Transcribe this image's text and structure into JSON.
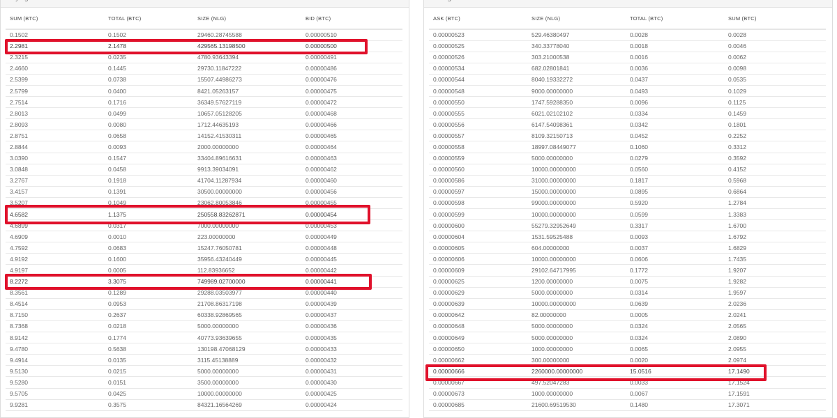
{
  "colors": {
    "highlight": "#e0112b",
    "border": "#dcdcdc"
  },
  "buying": {
    "title": "Buying",
    "columns": [
      "SUM (BTC)",
      "TOTAL (BTC)",
      "SIZE (NLG)",
      "BID (BTC)"
    ],
    "rows": [
      [
        "0.1502",
        "0.1502",
        "29460.28745588",
        "0.00000510"
      ],
      [
        "2.2981",
        "2.1478",
        "429565.13198500",
        "0.00000500"
      ],
      [
        "2.3215",
        "0.0235",
        "4780.93643394",
        "0.00000491"
      ],
      [
        "2.4660",
        "0.1445",
        "29730.11847222",
        "0.00000486"
      ],
      [
        "2.5399",
        "0.0738",
        "15507.44986273",
        "0.00000476"
      ],
      [
        "2.5799",
        "0.0400",
        "8421.05263157",
        "0.00000475"
      ],
      [
        "2.7514",
        "0.1716",
        "36349.57627119",
        "0.00000472"
      ],
      [
        "2.8013",
        "0.0499",
        "10657.05128205",
        "0.00000468"
      ],
      [
        "2.8093",
        "0.0080",
        "1712.44635193",
        "0.00000466"
      ],
      [
        "2.8751",
        "0.0658",
        "14152.41530311",
        "0.00000465"
      ],
      [
        "2.8844",
        "0.0093",
        "2000.00000000",
        "0.00000464"
      ],
      [
        "3.0390",
        "0.1547",
        "33404.89616631",
        "0.00000463"
      ],
      [
        "3.0848",
        "0.0458",
        "9913.39034091",
        "0.00000462"
      ],
      [
        "3.2767",
        "0.1918",
        "41704.11287934",
        "0.00000460"
      ],
      [
        "3.4157",
        "0.1391",
        "30500.00000000",
        "0.00000456"
      ],
      [
        "3.5207",
        "0.1049",
        "23062.80053846",
        "0.00000455"
      ],
      [
        "4.6582",
        "1.1375",
        "250558.83262871",
        "0.00000454"
      ],
      [
        "4.6899",
        "0.0317",
        "7000.00000000",
        "0.00000453"
      ],
      [
        "4.6909",
        "0.0010",
        "223.00000000",
        "0.00000449"
      ],
      [
        "4.7592",
        "0.0683",
        "15247.76050781",
        "0.00000448"
      ],
      [
        "4.9192",
        "0.1600",
        "35956.43240449",
        "0.00000445"
      ],
      [
        "4.9197",
        "0.0005",
        "112.83936652",
        "0.00000442"
      ],
      [
        "8.2272",
        "3.3075",
        "749989.02700000",
        "0.00000441"
      ],
      [
        "8.3561",
        "0.1289",
        "29288.03503977",
        "0.00000440"
      ],
      [
        "8.4514",
        "0.0953",
        "21708.86317198",
        "0.00000439"
      ],
      [
        "8.7150",
        "0.2637",
        "60338.92869565",
        "0.00000437"
      ],
      [
        "8.7368",
        "0.0218",
        "5000.00000000",
        "0.00000436"
      ],
      [
        "8.9142",
        "0.1774",
        "40773.93639655",
        "0.00000435"
      ],
      [
        "9.4780",
        "0.5638",
        "130198.47068129",
        "0.00000433"
      ],
      [
        "9.4914",
        "0.0135",
        "3115.45138889",
        "0.00000432"
      ],
      [
        "9.5130",
        "0.0215",
        "5000.00000000",
        "0.00000431"
      ],
      [
        "9.5280",
        "0.0151",
        "3500.00000000",
        "0.00000430"
      ],
      [
        "9.5705",
        "0.0425",
        "10000.00000000",
        "0.00000425"
      ],
      [
        "9.9281",
        "0.3575",
        "84321.16564269",
        "0.00000424"
      ]
    ],
    "highlighted_rows": [
      1,
      16,
      22
    ]
  },
  "selling": {
    "title": "Selling",
    "columns": [
      "ASK (BTC)",
      "SIZE (NLG)",
      "TOTAL (BTC)",
      "SUM (BTC)"
    ],
    "rows": [
      [
        "0.00000523",
        "529.46380497",
        "0.0028",
        "0.0028"
      ],
      [
        "0.00000525",
        "340.33778040",
        "0.0018",
        "0.0046"
      ],
      [
        "0.00000526",
        "303.21000538",
        "0.0016",
        "0.0062"
      ],
      [
        "0.00000534",
        "682.02801841",
        "0.0036",
        "0.0098"
      ],
      [
        "0.00000544",
        "8040.19332272",
        "0.0437",
        "0.0535"
      ],
      [
        "0.00000548",
        "9000.00000000",
        "0.0493",
        "0.1029"
      ],
      [
        "0.00000550",
        "1747.59288350",
        "0.0096",
        "0.1125"
      ],
      [
        "0.00000555",
        "6021.02102102",
        "0.0334",
        "0.1459"
      ],
      [
        "0.00000556",
        "6147.54098361",
        "0.0342",
        "0.1801"
      ],
      [
        "0.00000557",
        "8109.32150713",
        "0.0452",
        "0.2252"
      ],
      [
        "0.00000558",
        "18997.08449077",
        "0.1060",
        "0.3312"
      ],
      [
        "0.00000559",
        "5000.00000000",
        "0.0279",
        "0.3592"
      ],
      [
        "0.00000560",
        "10000.00000000",
        "0.0560",
        "0.4152"
      ],
      [
        "0.00000586",
        "31000.00000000",
        "0.1817",
        "0.5968"
      ],
      [
        "0.00000597",
        "15000.00000000",
        "0.0895",
        "0.6864"
      ],
      [
        "0.00000598",
        "99000.00000000",
        "0.5920",
        "1.2784"
      ],
      [
        "0.00000599",
        "10000.00000000",
        "0.0599",
        "1.3383"
      ],
      [
        "0.00000600",
        "55279.32952649",
        "0.3317",
        "1.6700"
      ],
      [
        "0.00000604",
        "1531.59525488",
        "0.0093",
        "1.6792"
      ],
      [
        "0.00000605",
        "604.00000000",
        "0.0037",
        "1.6829"
      ],
      [
        "0.00000606",
        "10000.00000000",
        "0.0606",
        "1.7435"
      ],
      [
        "0.00000609",
        "29102.64717995",
        "0.1772",
        "1.9207"
      ],
      [
        "0.00000625",
        "1200.00000000",
        "0.0075",
        "1.9282"
      ],
      [
        "0.00000629",
        "5000.00000000",
        "0.0314",
        "1.9597"
      ],
      [
        "0.00000639",
        "10000.00000000",
        "0.0639",
        "2.0236"
      ],
      [
        "0.00000642",
        "82.00000000",
        "0.0005",
        "2.0241"
      ],
      [
        "0.00000648",
        "5000.00000000",
        "0.0324",
        "2.0565"
      ],
      [
        "0.00000649",
        "5000.00000000",
        "0.0324",
        "2.0890"
      ],
      [
        "0.00000650",
        "1000.00000000",
        "0.0065",
        "2.0955"
      ],
      [
        "0.00000662",
        "300.00000000",
        "0.0020",
        "2.0974"
      ],
      [
        "0.00000666",
        "2260000.00000000",
        "15.0516",
        "17.1490"
      ],
      [
        "0.00000667",
        "497.52047283",
        "0.0033",
        "17.1524"
      ],
      [
        "0.00000673",
        "1000.00000000",
        "0.0067",
        "17.1591"
      ],
      [
        "0.00000685",
        "21600.69519530",
        "0.1480",
        "17.3071"
      ]
    ],
    "highlighted_rows": [
      30
    ]
  }
}
